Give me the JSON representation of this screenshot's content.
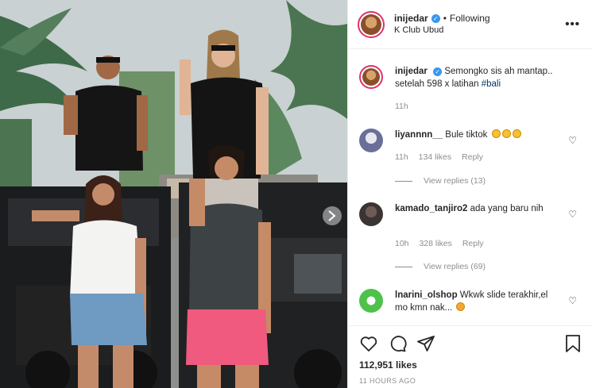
{
  "header": {
    "username": "inijedar",
    "verified_icon": "verified-icon",
    "separator": "•",
    "follow_status": "Following",
    "location": "K Club Ubud",
    "more_label": "•••"
  },
  "caption": {
    "username": "inijedar",
    "text_line1": "Semongko sis ah mantap..",
    "text_line2": "setelah 598 x latihan",
    "hashtag": "#bali",
    "time": "11h"
  },
  "comments": [
    {
      "username": "liyannnn__",
      "text": "Bule tiktok",
      "emoji_count": 3,
      "time": "11h",
      "likes": "134 likes",
      "reply_label": "Reply",
      "view_replies": "View replies (13)"
    },
    {
      "username": "kamado_tanjiro2",
      "text": "ada yang baru nih",
      "time": "10h",
      "likes": "328 likes",
      "reply_label": "Reply",
      "view_replies": "View replies (69)"
    },
    {
      "username": "lnarini_olshop",
      "text": "Wkwk slide terakhir,el mo kmn nak...",
      "emoji_count": 1
    }
  ],
  "actions": {
    "icons": [
      "heart-icon",
      "comment-icon",
      "share-icon",
      "bookmark-icon"
    ],
    "likes": "112,951 likes",
    "timestamp": "11 HOURS AGO"
  },
  "colors": {
    "verified": "#3897f0",
    "link": "#00376b",
    "muted": "#8e8e8e",
    "border": "#efefef"
  }
}
